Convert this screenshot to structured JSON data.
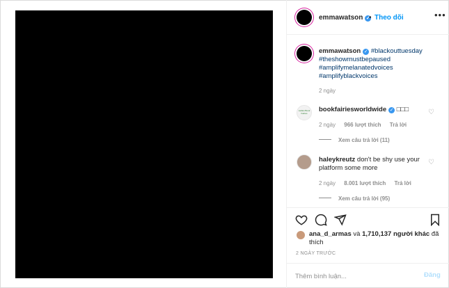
{
  "header": {
    "username": "emmawatson",
    "dot": "•",
    "follow_label": "Theo dõi",
    "more_icon": "more-horizontal-icon"
  },
  "caption": {
    "username": "emmawatson",
    "hashtags": [
      "#blackouttuesday",
      "#theshowmustbepaused",
      "#amplifymelanatedvoices",
      "#amplifyblackvoices"
    ],
    "time": "2 ngày"
  },
  "comments": [
    {
      "username": "bookfairiesworldwide",
      "text": "□□□",
      "avatar_text": "Ladies Book Fairies",
      "time": "2 ngày",
      "likes": "966 lượt thích",
      "reply_label": "Trả lời",
      "view_replies": "Xem câu trả lời (11)"
    },
    {
      "username": "haleykreutz",
      "text": "don't be shy use your platform some more",
      "time": "2 ngày",
      "likes": "8.001 lượt thích",
      "reply_label": "Trả lời",
      "view_replies": "Xem câu trả lời (95)"
    }
  ],
  "likes": {
    "user": "ana_d_armas",
    "and_text": "và",
    "count_text": "1,710,137 người khác",
    "suffix": "đã thích"
  },
  "date": "2 NGÀY TRƯỚC",
  "add_comment": {
    "placeholder": "Thêm bình luận...",
    "post_label": "Đăng"
  },
  "colors": {
    "accent": "#0095f6",
    "verified": "#3897f0",
    "hashtag": "#00376b",
    "muted": "#8e8e8e",
    "post_disabled": "#b2dffc"
  }
}
